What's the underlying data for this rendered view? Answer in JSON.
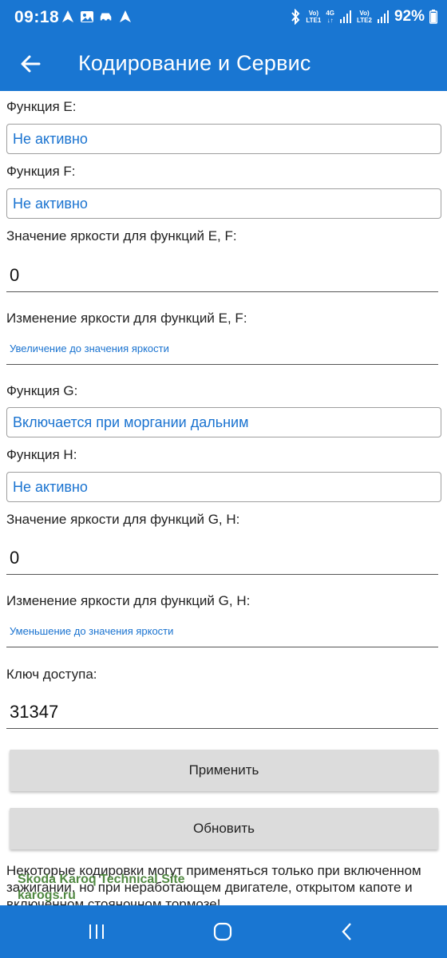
{
  "status_bar": {
    "time": "09:18",
    "battery": "92%",
    "volte1": "Vo)",
    "lte1": "LTE1",
    "net4g": "4G",
    "volte2": "Vo)",
    "lte2": "LTE2",
    "icons": [
      "navigation-icon",
      "image-icon",
      "car-icon",
      "navigation-icon",
      "bluetooth-icon",
      "signal-icon",
      "battery-icon"
    ]
  },
  "app_bar": {
    "title": "Кодирование и Сервис",
    "back_icon": "arrow-back-icon"
  },
  "form": {
    "function_e": {
      "label": "Функция E:",
      "value": "Не активно"
    },
    "function_f": {
      "label": "Функция F:",
      "value": "Не активно"
    },
    "brightness_ef": {
      "label": "Значение яркости для функций E, F:",
      "value": "0"
    },
    "brightness_change_ef": {
      "label": "Изменение яркости для функций E, F:",
      "value": "Увеличение до значения яркости"
    },
    "function_g": {
      "label": "Функция G:",
      "value": "Включается при моргании дальним"
    },
    "function_h": {
      "label": "Функция H:",
      "value": "Не активно"
    },
    "brightness_gh": {
      "label": "Значение яркости для функций G, H:",
      "value": "0"
    },
    "brightness_change_gh": {
      "label": "Изменение яркости для функций G, H:",
      "value": "Уменьшение до значения яркости"
    },
    "access_key": {
      "label": "Ключ доступа:",
      "value": "31347"
    }
  },
  "buttons": {
    "apply": "Применить",
    "refresh": "Обновить"
  },
  "note": "Некоторые кодировки могут применяться только при включенном зажигании, но при неработающем двигателе, открытом капоте и включенном стояночном тормозе!",
  "watermark": {
    "line1": "Skoda Karoq Technical Site",
    "line2": "karogs.ru"
  },
  "colors": {
    "primary": "#1976d2",
    "value_blue": "#1a73d0",
    "button_gray": "#dcdcdc",
    "watermark_green": "#3f7d2e"
  }
}
